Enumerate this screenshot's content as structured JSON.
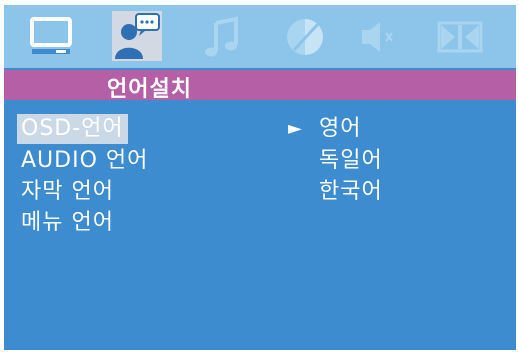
{
  "icons": [
    {
      "name": "picture-icon",
      "active": false
    },
    {
      "name": "language-icon",
      "active": true
    },
    {
      "name": "audio-icon",
      "active": false
    },
    {
      "name": "color-icon",
      "active": false
    },
    {
      "name": "volume-icon",
      "active": false
    },
    {
      "name": "video-icon",
      "active": false
    }
  ],
  "title": "언어설치",
  "menu": {
    "items": [
      {
        "label": "OSD-언어",
        "selected": true
      },
      {
        "label": "AUDIO 언어",
        "selected": false
      },
      {
        "label": "자막 언어",
        "selected": false
      },
      {
        "label": "메뉴 언어",
        "selected": false
      }
    ]
  },
  "options": {
    "marker": "►",
    "items": [
      "영어",
      "독일어",
      "한국어"
    ],
    "selected_index": 0
  },
  "colors": {
    "background": "#3e8cd0",
    "icon_bar": "#8cc5e9",
    "title_bar": "#b45fa6",
    "highlight": "#cbd8e6",
    "text": "#ffffff"
  }
}
